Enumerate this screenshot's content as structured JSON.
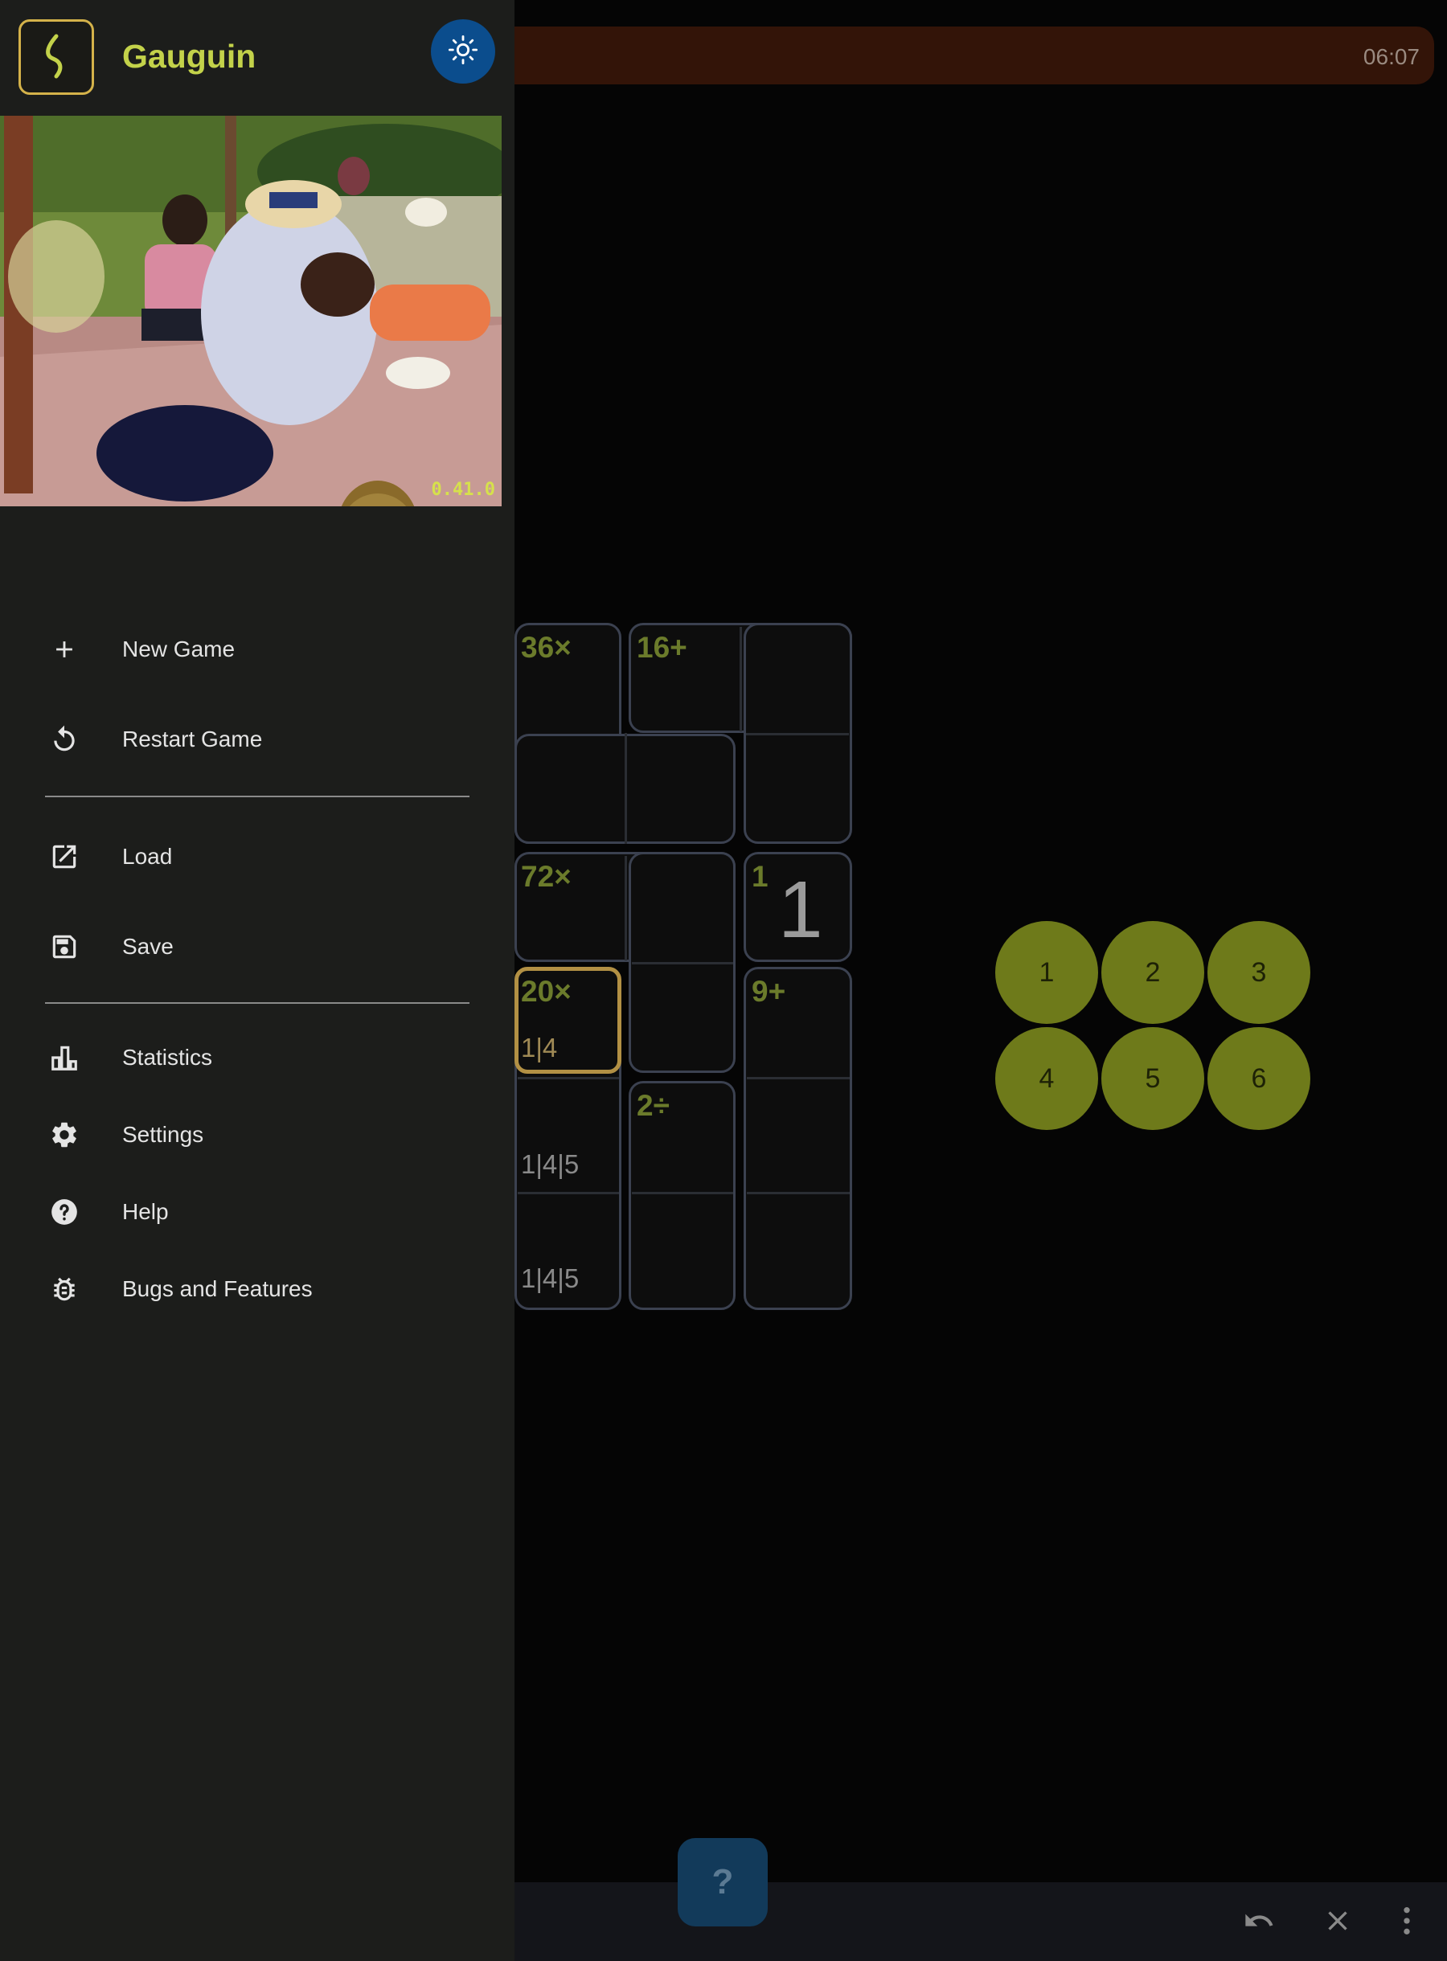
{
  "timer": "06:07",
  "drawer": {
    "app_name": "Gauguin",
    "version": "0.41.0",
    "menu": {
      "new_game": "New Game",
      "restart_game": "Restart Game",
      "load": "Load",
      "save": "Save",
      "statistics": "Statistics",
      "settings": "Settings",
      "help": "Help",
      "bugs": "Bugs and Features"
    }
  },
  "grid": {
    "cages": {
      "c1": "36×",
      "c2": "16+",
      "c3": "72×",
      "c4": "1",
      "c5": "20×",
      "c6": "9+",
      "c7": "2÷"
    },
    "values": {
      "r3c3": "1"
    },
    "notes": {
      "r4c1": "1|4",
      "r5c1": "1|4|5",
      "r6c1": "1|4|5"
    }
  },
  "numpad": [
    "1",
    "2",
    "3",
    "4",
    "5",
    "6"
  ],
  "fab_label": "?",
  "colors": {
    "accent": "#c3d24a",
    "numpad": "#6e7a1a",
    "timer_bar": "#331408",
    "selection": "#b29044"
  },
  "icons": [
    "undo-icon",
    "close-icon",
    "more-vert-icon",
    "help-icon",
    "theme-sun-icon"
  ]
}
